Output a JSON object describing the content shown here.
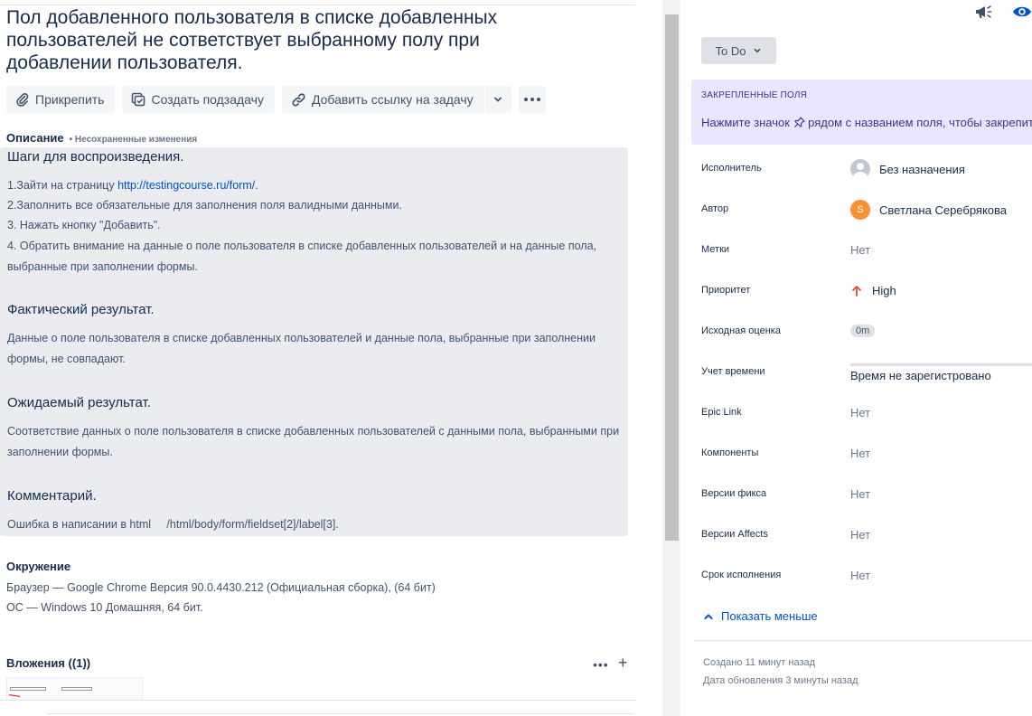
{
  "issue": {
    "title": "Пол добавленного пользователя в списке добавленных пользователей не сответствует выбранному полу при добавлении пользователя."
  },
  "toolbar": {
    "attach_label": "Прикрепить",
    "subtask_label": "Создать подзадачу",
    "link_label": "Добавить ссылку на задачу"
  },
  "description": {
    "heading": "Описание",
    "unsaved": "• Несохраненные изменения",
    "steps_title": "Шаги для воспроизведения.",
    "step1_prefix": "1.Зайти на страницу ",
    "step1_link": "http://testingcourse.ru/form/",
    "step1_suffix": ".",
    "step2": "2.Заполнить все обязательные для заполнения поля валидными данными.",
    "step3": "3. Нажать кнопку \"Добавить\".",
    "step4": "4. Обратить внимание на данные о поле пользователя в списке добавленных пользователей и на данные пола, выбранные при заполнении формы.",
    "actual_title": "Фактический результат.",
    "actual_text": "Данные о поле пользователя в списке добавленных пользователей и данные пола, выбранные при заполнении формы, не совпадают.",
    "expected_title": "Ожидаемый результат.",
    "expected_text": "Соответствие данных о поле пользователя в списке добавленных пользователей с данными пола, выбранными при заполнении формы.",
    "comment_title": "Комментарий.",
    "comment_text": "Ошибка в написании в html     /html/body/form/fieldset[2]/label[3]."
  },
  "environment": {
    "title": "Окружение",
    "line1": "Браузер —  Google Chrome Версия 90.0.4430.212 (Официальная сборка), (64 бит)",
    "line2": "ОС — Windows 10 Домашняя, 64 бит."
  },
  "attachments": {
    "title": "Вложения ((1))",
    "more": "•••",
    "add": "+"
  },
  "sidebar": {
    "status": "To Do",
    "pinned_title": "ЗАКРЕПЛЕННЫЕ ПОЛЯ",
    "pinned_text_a": "Нажмите значок ",
    "pinned_text_b": " рядом с названием поля, чтобы закрепить",
    "fields": [
      {
        "label": "Исполнитель",
        "value": "Без назначения"
      },
      {
        "label": "Автор",
        "value": "Светлана Серебрякова",
        "avatar_letter": "S"
      },
      {
        "label": "Метки",
        "value": "Нет"
      },
      {
        "label": "Приоритет",
        "value": "High"
      },
      {
        "label": "Исходная оценка",
        "value": "0m"
      },
      {
        "label": "Учет времени",
        "value": "Время не зарегистровано"
      },
      {
        "label": "Epic Link",
        "value": "Нет"
      },
      {
        "label": "Компоненты",
        "value": "Нет"
      },
      {
        "label": "Версии фикса",
        "value": "Нет"
      },
      {
        "label": "Версии Affects",
        "value": "Нет"
      },
      {
        "label": "Срок исполнения",
        "value": "Нет"
      }
    ],
    "show_less": "Показать меньше",
    "created": "Создано 11 минут назад",
    "updated": "Дата обновления 3 минуты назад"
  },
  "icons": {
    "attach": "paperclip-icon",
    "subtask": "subtask-icon",
    "link": "link-icon",
    "caret": "chevron-down-icon",
    "more": "more-icon",
    "feedback": "megaphone-icon",
    "watch": "eye-icon",
    "pin": "pin-icon",
    "priority": "arrow-up-icon",
    "collapse": "chevron-up-icon"
  },
  "colors": {
    "link": "#0052cc",
    "priority_high": "#e5493a",
    "pinned_bg": "#eae6ff",
    "description_bg": "#ebecf0",
    "author_avatar": "#f79232"
  }
}
